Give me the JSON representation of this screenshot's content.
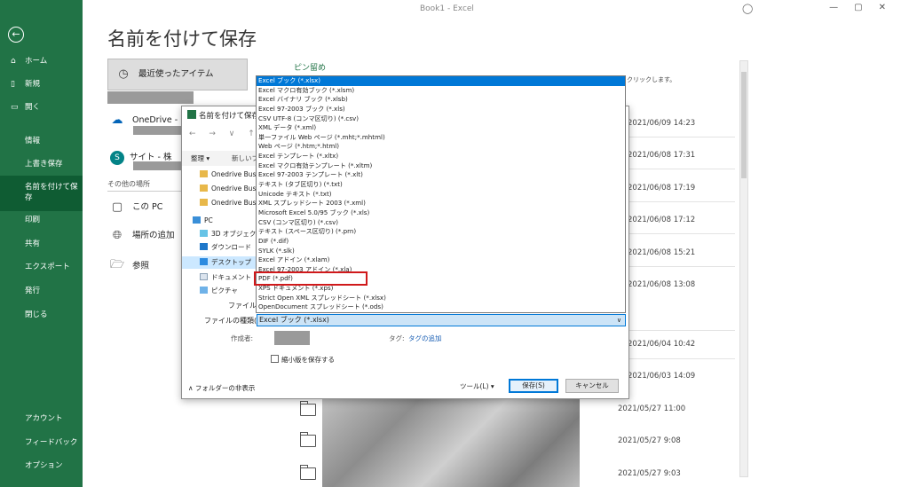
{
  "window": {
    "title": "Book1  -  Excel",
    "user_icon": "person-icon",
    "controls": [
      "—",
      "▢",
      "✕"
    ]
  },
  "sidebar": {
    "back_icon": "back-arrow-icon",
    "items": [
      {
        "label": "ホーム",
        "icon": "home-icon"
      },
      {
        "label": "新規",
        "icon": "new-file-icon"
      },
      {
        "label": "開く",
        "icon": "open-folder-icon"
      },
      {
        "label": "情報"
      },
      {
        "label": "上書き保存"
      },
      {
        "label": "名前を付けて保存",
        "active": true
      },
      {
        "label": "印刷"
      },
      {
        "label": "共有"
      },
      {
        "label": "エクスポート"
      },
      {
        "label": "発行"
      },
      {
        "label": "閉じる"
      },
      {
        "label": "アカウント"
      },
      {
        "label": "フィードバック"
      },
      {
        "label": "オプション"
      }
    ]
  },
  "page_title": "名前を付けて保存",
  "locations": {
    "recent": "最近使ったアイテム",
    "onedrive": "OneDrive -",
    "sites": "サイト - 株",
    "other_label": "その他の場所",
    "this_pc": "この PC",
    "add_place": "場所の追加",
    "browse": "参照"
  },
  "right_panel": {
    "pinned_label": "ピン留め",
    "hint": "クリックします。",
    "dates": [
      "2021/06/09 14:23",
      "2021/06/08 17:31",
      "2021/06/08 17:19",
      "2021/06/08 17:12",
      "2021/06/08 15:21",
      "2021/06/08 13:08",
      "2021/06/04 10:42",
      "2021/06/03 14:09",
      "2021/05/27 11:00",
      "2021/05/27 9:08",
      "2021/05/27 9:03"
    ]
  },
  "dialog": {
    "title": "名前を付けて保存",
    "nav": "←  →  ∨  ↑",
    "organize": "整理 ▾",
    "new_folder": "新しいフォ",
    "tree": [
      {
        "label": "Onedrive Busi",
        "type": "folder"
      },
      {
        "label": "Onedrive Busi",
        "type": "folder"
      },
      {
        "label": "Onedrive Busi",
        "type": "folder"
      },
      {
        "label": "PC",
        "type": "pc"
      },
      {
        "label": "3D オブジェクト",
        "type": "3d"
      },
      {
        "label": "ダウンロード",
        "type": "download"
      },
      {
        "label": "デスクトップ",
        "type": "desktop",
        "selected": true
      },
      {
        "label": "ドキュメント",
        "type": "document"
      },
      {
        "label": "ピクチャ",
        "type": "picture"
      }
    ],
    "filename_label": "ファイル名(N):",
    "filetype_label": "ファイルの種類(T):",
    "filetype_value": "Excel ブック (*.xlsx)",
    "author_label": "作成者:",
    "tag_label": "タグ:",
    "tag_link": "タグの追加",
    "thumbnail_label": "縮小版を保存する",
    "hide_folders": "フォルダーの非表示",
    "tools": "ツール(L)  ▾",
    "save": "保存(S)",
    "cancel": "キャンセル"
  },
  "type_list": {
    "highlight_color": "#d0191b",
    "options": [
      "Excel ブック (*.xlsx)",
      "Excel マクロ有効ブック (*.xlsm)",
      "Excel バイナリ ブック (*.xlsb)",
      "Excel 97-2003 ブック (*.xls)",
      "CSV UTF-8 (コンマ区切り) (*.csv)",
      "XML データ (*.xml)",
      "単一ファイル Web ページ (*.mht;*.mhtml)",
      "Web ページ (*.htm;*.html)",
      "Excel テンプレート (*.xltx)",
      "Excel マクロ有効テンプレート (*.xltm)",
      "Excel 97-2003 テンプレート (*.xlt)",
      "テキスト (タブ区切り) (*.txt)",
      "Unicode テキスト (*.txt)",
      "XML スプレッドシート 2003 (*.xml)",
      "Microsoft Excel 5.0/95 ブック (*.xls)",
      "CSV (コンマ区切り) (*.csv)",
      "テキスト (スペース区切り) (*.prn)",
      "DIF (*.dif)",
      "SYLK (*.slk)",
      "Excel アドイン (*.xlam)",
      "Excel 97-2003 アドイン (*.xla)",
      "PDF (*.pdf)",
      "XPS ドキュメント (*.xps)",
      "Strict Open XML スプレッドシート (*.xlsx)",
      "OpenDocument スプレッドシート (*.ods)"
    ]
  }
}
